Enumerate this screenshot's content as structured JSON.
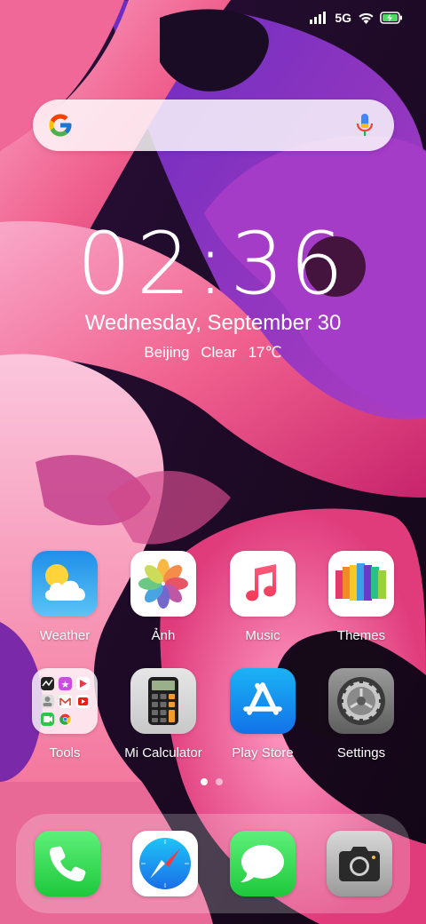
{
  "status_bar": {
    "network": "5G"
  },
  "search": {
    "assistant": "google-search"
  },
  "clock": {
    "time": "02:36"
  },
  "date": {
    "text": "Wednesday, September 30"
  },
  "weather": {
    "city": "Beijing",
    "condition": "Clear",
    "temperature": "17℃"
  },
  "apps": [
    {
      "label": "Weather",
      "icon": "weather-icon"
    },
    {
      "label": "Ảnh",
      "icon": "photos-icon"
    },
    {
      "label": "Music",
      "icon": "music-icon"
    },
    {
      "label": "Themes",
      "icon": "themes-icon"
    },
    {
      "label": "Tools",
      "icon": "folder-icon"
    },
    {
      "label": "Mi Calculator",
      "icon": "calculator-icon"
    },
    {
      "label": "Play Store",
      "icon": "app-store-icon"
    },
    {
      "label": "Settings",
      "icon": "settings-gear-icon"
    }
  ],
  "dock": [
    {
      "icon": "phone-icon"
    },
    {
      "icon": "safari-compass-icon"
    },
    {
      "icon": "messages-icon"
    },
    {
      "icon": "camera-icon"
    }
  ],
  "page_indicator": {
    "pages": 2,
    "current": 1
  },
  "colors": {
    "wallpaper_pink": "#f05a8c",
    "wallpaper_purple": "#7a2ab8"
  }
}
